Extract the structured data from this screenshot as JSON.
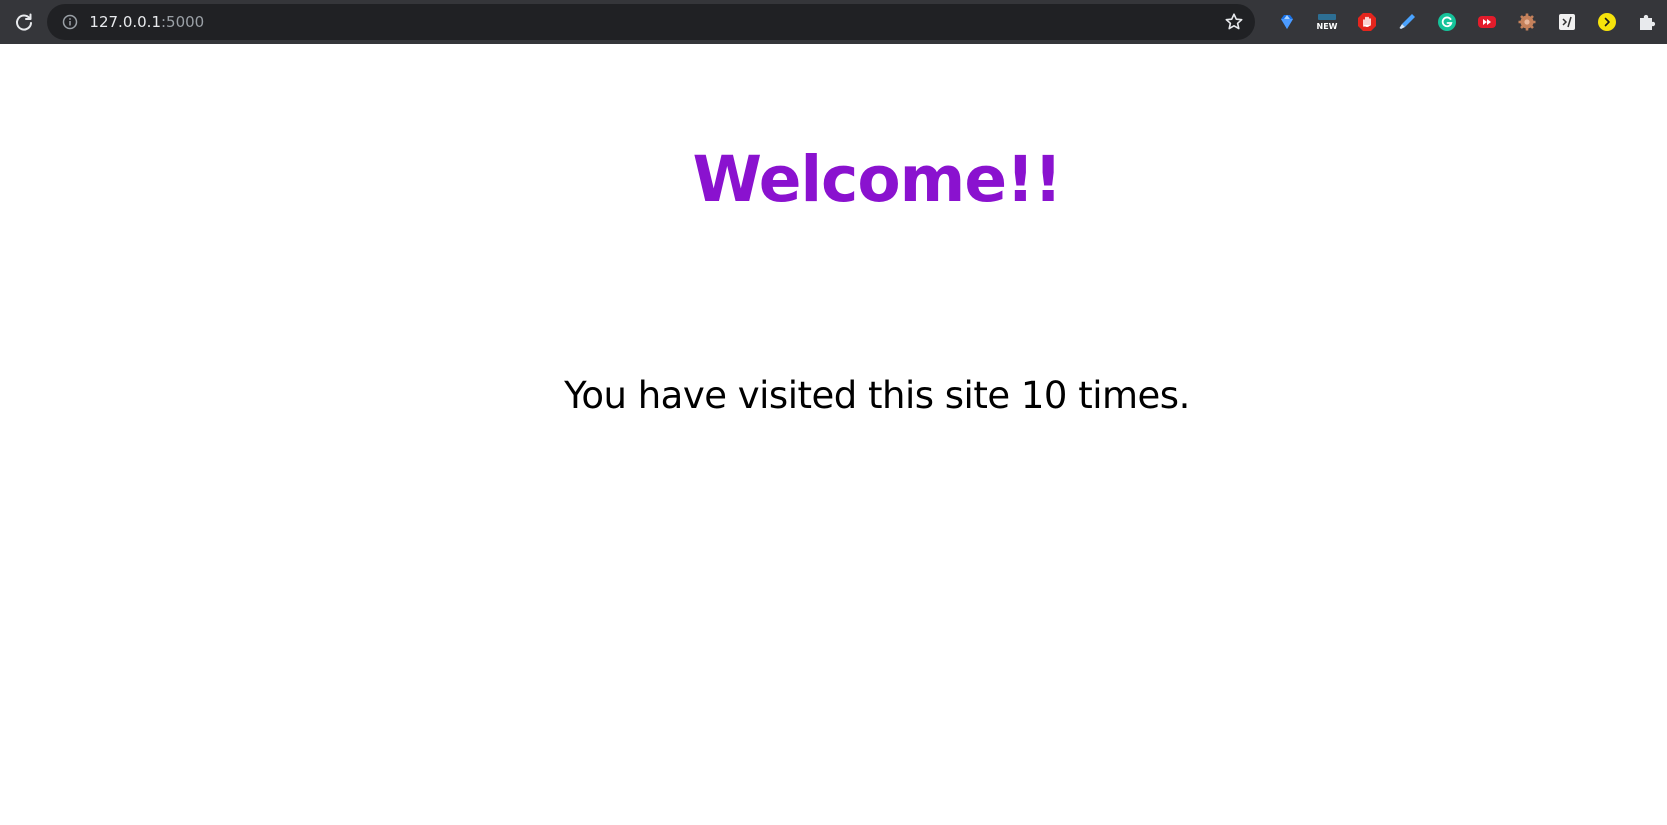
{
  "browser": {
    "url_host": "127.0.0.1",
    "url_port": ":5000",
    "icons": {
      "reload": "reload-icon",
      "site_info": "info-icon",
      "bookmark": "star-icon"
    },
    "extensions": [
      {
        "name": "gem-extension-icon",
        "color": "#1a73e8"
      },
      {
        "name": "new-badge-extension-icon",
        "label": "NEW",
        "color": "#2d6f94"
      },
      {
        "name": "stop-hand-extension-icon",
        "color": "#e4251d"
      },
      {
        "name": "highlighter-extension-icon",
        "color": "#4aa3ff"
      },
      {
        "name": "grammarly-extension-icon",
        "color": "#15c39a"
      },
      {
        "name": "fast-forward-extension-icon",
        "color": "#e31c2b"
      },
      {
        "name": "gear-extension-icon",
        "color": "#c5815b"
      },
      {
        "name": "script-extension-icon",
        "color": "#f1f1f1"
      },
      {
        "name": "arrow-extension-icon",
        "color": "#f6e30b"
      },
      {
        "name": "puzzle-extensions-icon",
        "color": "#e8eaed"
      }
    ]
  },
  "page": {
    "title": "Welcome!!",
    "visit_message": "You have visited this site 10 times.",
    "title_color": "#8a12cf",
    "message_color": "#000000"
  }
}
